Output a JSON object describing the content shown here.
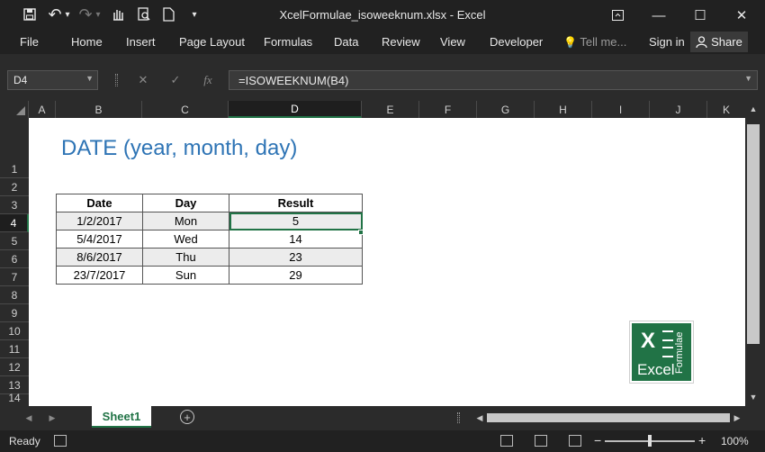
{
  "window": {
    "title": "XcelFormulae_isoweeknum.xlsx - Excel",
    "ribbon_display_icon": "ribbon-display-icon",
    "minimize": "—",
    "maximize": "☐",
    "close": "✕"
  },
  "quick_access": {
    "save": "save-icon",
    "undo": "↶",
    "undo_dd": "▾",
    "redo": "↷",
    "redo_dd": "▾",
    "touch": "touch-mode-icon",
    "preview": "print-preview-icon",
    "newdoc": "new-document-icon",
    "more": "▾"
  },
  "menu": {
    "tabs": [
      "File",
      "Home",
      "Insert",
      "Page Layout",
      "Formulas",
      "Data",
      "Review",
      "View",
      "Developer"
    ],
    "tell_me": "Tell me...",
    "sign_in": "Sign in",
    "share": "Share"
  },
  "formula_bar": {
    "name_box": "D4",
    "cancel": "✕",
    "enter": "✓",
    "fx": "fx",
    "formula": "=ISOWEEKNUM(B4)"
  },
  "columns": [
    "A",
    "B",
    "C",
    "D",
    "E",
    "F",
    "G",
    "H",
    "I",
    "J",
    "K"
  ],
  "rows": [
    "1",
    "2",
    "3",
    "4",
    "5",
    "6",
    "7",
    "8",
    "9",
    "10",
    "11",
    "12",
    "13",
    "14"
  ],
  "sheet": {
    "heading": "DATE (year, month, day)",
    "table": {
      "headers": [
        "Date",
        "Day",
        "Result"
      ],
      "rows": [
        [
          "1/2/2017",
          "Mon",
          "5"
        ],
        [
          "5/4/2017",
          "Wed",
          "14"
        ],
        [
          "8/6/2017",
          "Thu",
          "23"
        ],
        [
          "23/7/2017",
          "Sun",
          "29"
        ]
      ]
    }
  },
  "logo": {
    "letter": "X",
    "word": "Excel",
    "vertical": "Formulae"
  },
  "tabs_bar": {
    "active_sheet": "Sheet1",
    "add": "+"
  },
  "status": {
    "ready": "Ready",
    "zoom_minus": "−",
    "zoom_plus": "+",
    "zoom": "100%"
  },
  "colors": {
    "accent": "#217346",
    "heading": "#2e74b5",
    "chrome": "#212121"
  }
}
